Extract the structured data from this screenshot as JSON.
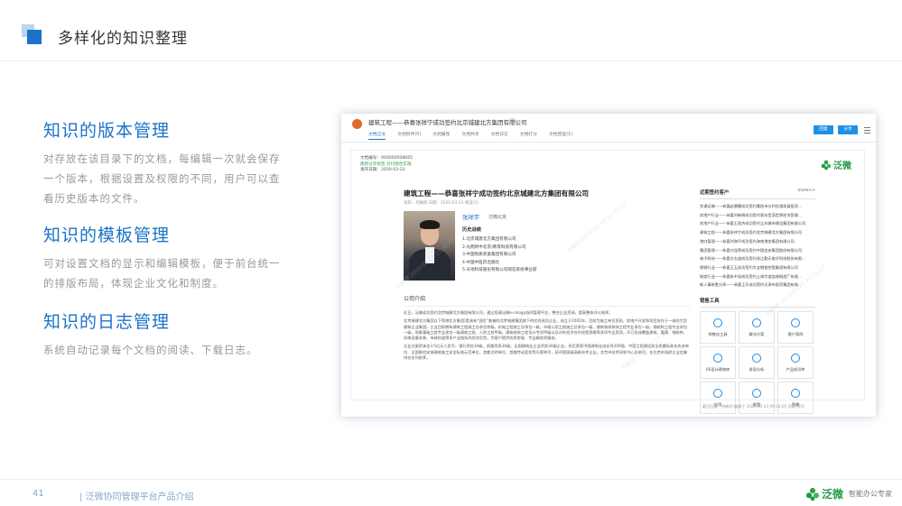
{
  "slide": {
    "title": "多样化的知识整理",
    "page_number": "41",
    "footer_text": "| 泛微协同管理平台产品介绍",
    "footer_logo_text": "泛微",
    "footer_slogan": "智能办公专家"
  },
  "sections": [
    {
      "heading": "知识的版本管理",
      "body": "对存放在该目录下的文档，每编辑一次就会保存一个版本，根据设置及权限的不同，用户可以查看历史版本的文件。"
    },
    {
      "heading": "知识的模板管理",
      "body": "可对设置文档的显示和编辑模板，便于前台统一的排版布局，体现企业文化和制度。"
    },
    {
      "heading": "知识的日志管理",
      "body": "系统自动记录每个文档的阅读、下载日志。"
    }
  ],
  "screenshot": {
    "doc_title": "建筑工程——恭喜张祥宁成功签约北京城建北方集团有限公司",
    "views": "(8)",
    "tabs": [
      "文档正文",
      "文档附件(0)",
      "文档属性",
      "文档共享",
      "文档日志",
      "文档打分",
      "文档回复(1)"
    ],
    "buttons": [
      "回复",
      "分享"
    ],
    "meta_lines": [
      "文档编号：000000508665",
      "建新分享标签 对付部合实践",
      "发布日期：2020-03-23"
    ],
    "logo_text": "泛微",
    "article_title": "建筑工程——恭喜张祥宁成功签约北京城建北方集团有限公司",
    "article_meta": "发布：刘敏明    日期：2020-03-23    阅读(2)",
    "profile_name": "张祥宇",
    "profile_company": "泛微北京",
    "profile_subtitle": "历史战绩",
    "profile_items": [
      "1.北京城建北方集团有限公司",
      "2.光明新中北京)教育科技有限公司",
      "3.中国地质装备集团有限公司",
      "4.中国中医药出版社",
      "5.天地科技股份有限公司煤炭系统事业部"
    ],
    "section_title": "公司介绍",
    "paragraphs": [
      "近日，泛微成功签约北京城建北方集团有限公司，通过搭建泛微e-cology协同管理平台，整合企业资源，提高整体办公效率。",
      "北京城建北方集团以下简称北方集团)是具有“国优”美誉的北京城建集团旗下的优秀成员企业，成立于2002年。目前为施工单位资质，房地产开发和项目协作于一体的大型建筑企业集团。企业目前拥有建筑工程施工总承包特级，机电工程施工总承包一级，市政公用工程施工总承包一级，建筑装修装饰工程专业承包一级，钢结构工程专业承包一级，地基基础工程专业承包一级建筑工程、人防工程甲级，建筑装饰工程设计专项甲级以及对外经济合作经营资格等多项专业资质，开已形成覆盖建筑、篇建、钢结构、机电设备安装、市政轨道等多产业链条的综合优势，为客户提供优质房屋、专业精良的服务。",
      "企业注册资本金3.5亿元人民币，银行资信3A级，质量资质3A级，全国建筑业企业资质3A级企业，先后荣获中国建筑业成长性200强、中国工程建设安全质量标准化先进单位、全国勇信安城建筑施工安全标准示范单位、首都文明单位、首都劳动奖状等光荣称号，获评国家级高新技术企业，北京市技术研发中心及单位，在北京市场综企业信誉排名名列前茅。"
    ],
    "side_title": "近期签约客户",
    "side_more": "more>>",
    "clients": [
      "交通运输——恭喜赵晨曦成功签约惠阳市水利交通发展投资…",
      "房地产行业——恭喜刘新佩成功签约青岛世茂世界经济贸建…",
      "房地产行业——恭喜王丽杰成功签约江苏城市建设集团有限公司",
      "建筑工程——恭喜张祥宁成功签约北京城建北方集团有限公司",
      "港口管理——恭喜刘海平成功签约海南港务集团有限公司",
      "集团管理——恭喜刘龙荣成功签约中国金安集团股份有限公司",
      "电子科技——恭喜方志波成功签约浙江勤天电子科技股份有限…",
      "钢铁行业——恭喜王玉成功签约大宝钢铁控股集团有限公司",
      "制造行业——恭喜朱中浩成功签约上海华谊血液制造厂有限…",
      "新人事新胜分享——恭喜王乐成功签约天津市医药集团有限…"
    ],
    "tools_title": "销售工具",
    "tools": [
      {
        "label": "销售化工具",
        "icon": "gear-icon"
      },
      {
        "label": "解决方案",
        "icon": "document-icon"
      },
      {
        "label": "客户案例",
        "icon": "user-icon"
      },
      {
        "label": "US设计建筑库",
        "icon": "image-icon"
      },
      {
        "label": "发现分析",
        "icon": "chart-icon"
      },
      {
        "label": "产品知识库",
        "icon": "book-icon"
      },
      {
        "label": "应用",
        "icon": "apps-icon"
      },
      {
        "label": "视频",
        "icon": "video-icon"
      },
      {
        "label": "直播",
        "icon": "play-icon"
      }
    ],
    "status_bar": "最后回复：刘敏明    编辑于 2020-03-23 09:04:05    阅读 (55)",
    "watermark": "刘敏明 2020-03-23 11:31:57"
  }
}
